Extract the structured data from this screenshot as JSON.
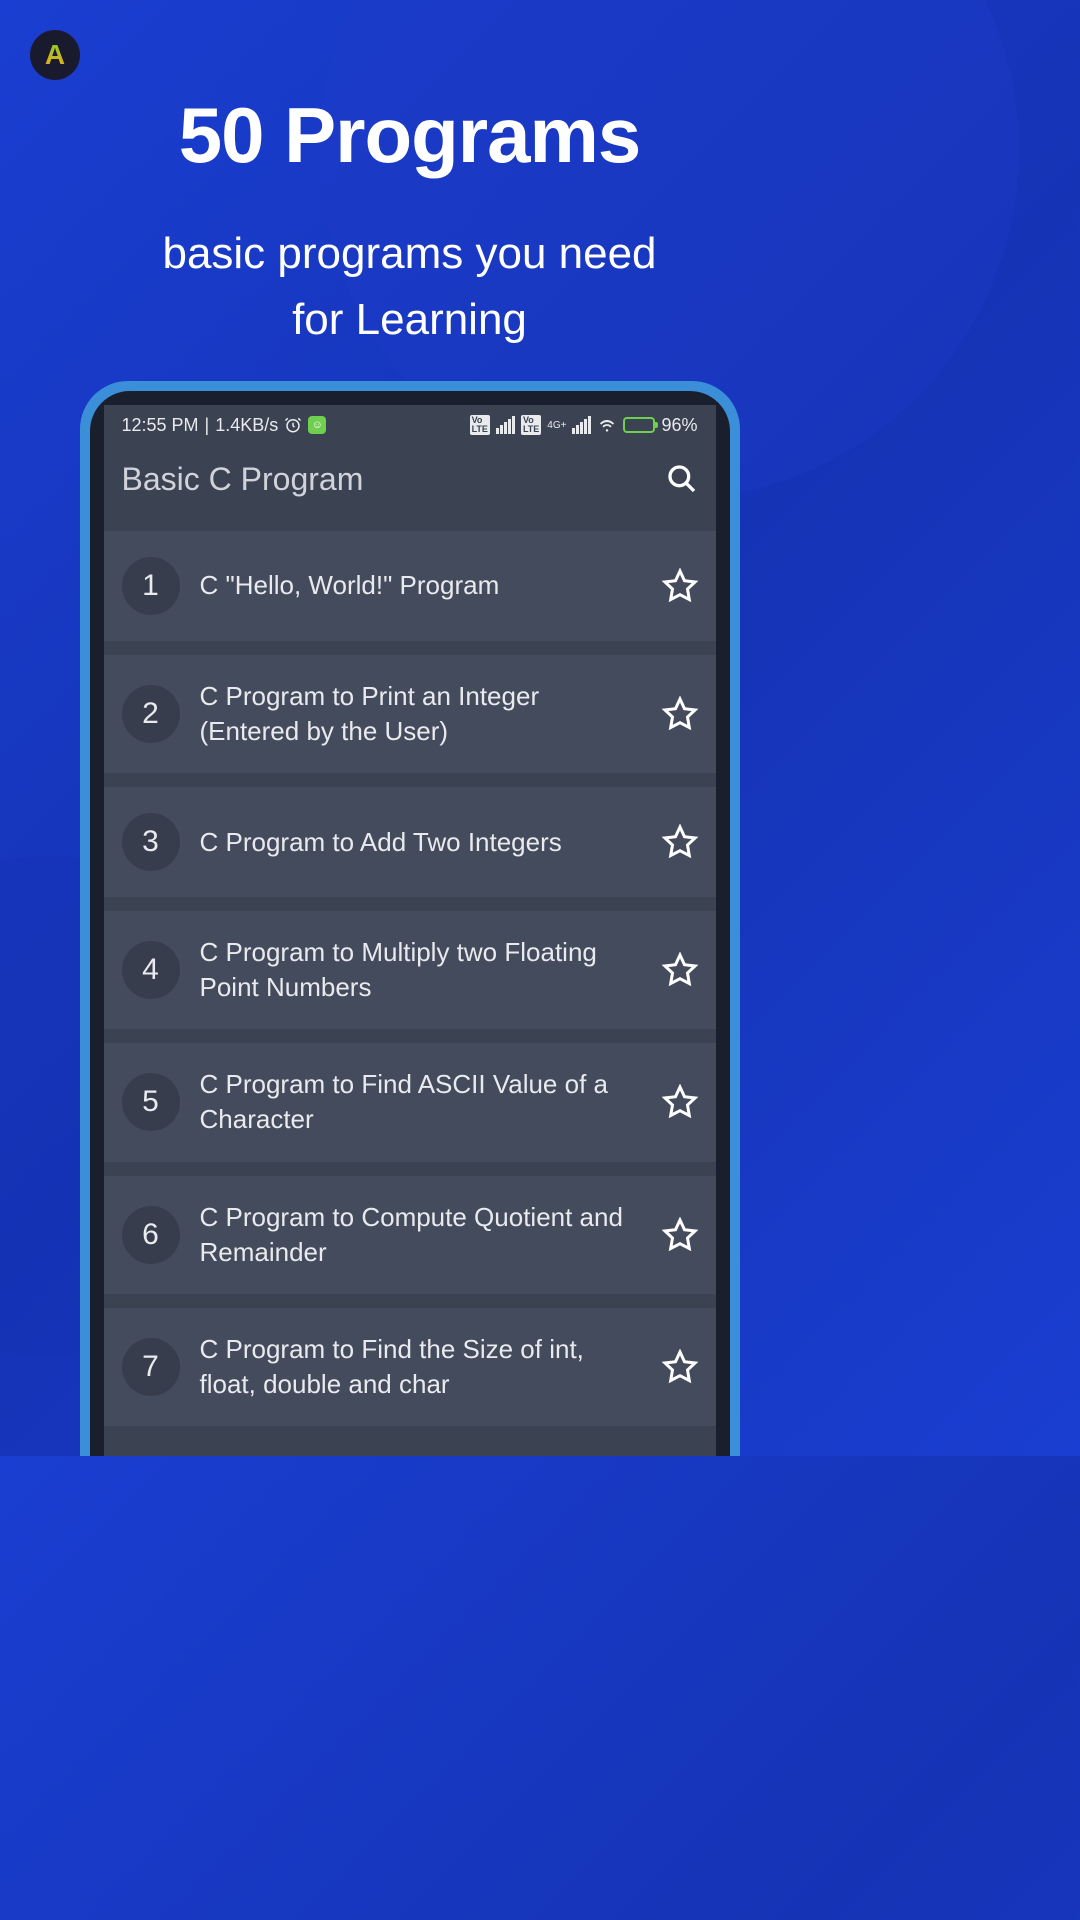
{
  "hero": {
    "title": "50 Programs",
    "subtitle_line1": "basic programs you need",
    "subtitle_line2": "for Learning"
  },
  "status_bar": {
    "time": "12:55 PM",
    "data_rate": "1.4KB/s",
    "battery_percent": "96%",
    "network_label": "4G+"
  },
  "app": {
    "title": "Basic C Program"
  },
  "programs": [
    {
      "number": "1",
      "title": "C \"Hello, World!\" Program"
    },
    {
      "number": "2",
      "title": "C Program to Print an Integer (Entered by the User)"
    },
    {
      "number": "3",
      "title": "C Program to Add Two Integers"
    },
    {
      "number": "4",
      "title": "C Program to Multiply two Floating Point Numbers"
    },
    {
      "number": "5",
      "title": "C Program to Find ASCII Value of a Character"
    },
    {
      "number": "6",
      "title": "C Program to Compute Quotient and Remainder"
    },
    {
      "number": "7",
      "title": "C Program to Find the Size of int, float, double and char"
    }
  ]
}
